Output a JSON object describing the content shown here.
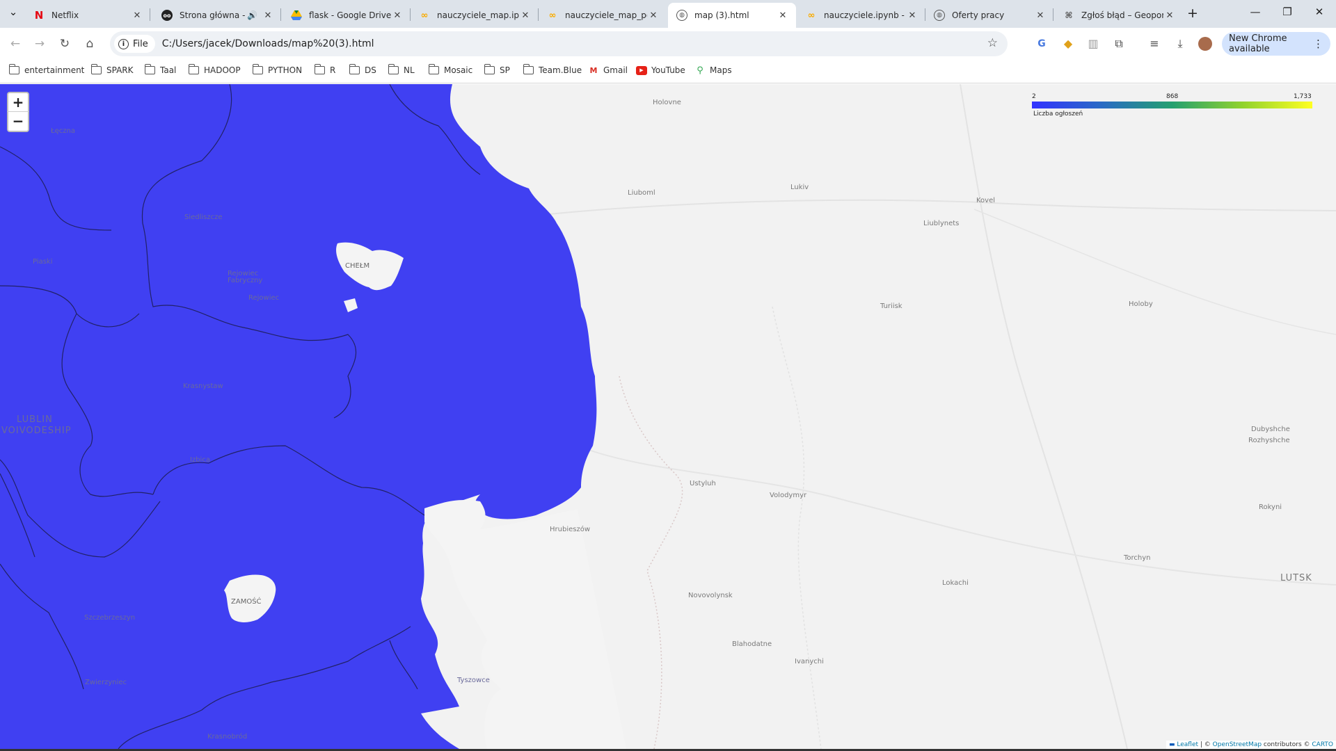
{
  "tabs": [
    {
      "title": "Netflix",
      "icon": "netflix-icon",
      "active": false
    },
    {
      "title": "Strona główna - P",
      "icon": "site-icon",
      "active": false
    },
    {
      "title": "flask - Google Drive",
      "icon": "google-drive-icon",
      "active": false
    },
    {
      "title": "nauczyciele_map.ipyn",
      "icon": "colab-icon",
      "active": false
    },
    {
      "title": "nauczyciele_map_pos",
      "icon": "colab-icon",
      "active": false
    },
    {
      "title": "map (3).html",
      "icon": "globe-icon",
      "active": true
    },
    {
      "title": "nauczyciele.ipynb - C",
      "icon": "colab-icon",
      "active": false
    },
    {
      "title": "Oferty pracy",
      "icon": "globe-icon",
      "active": false
    },
    {
      "title": "Zgłoś błąd – Geopor",
      "icon": "geoportal-icon",
      "active": false
    }
  ],
  "toolbar": {
    "chip_label": "File",
    "url": "C:/Users/jacek/Downloads/map%20(3).html",
    "update_label": "New Chrome available"
  },
  "bookmarks": [
    {
      "label": "entertainment",
      "icon": "folder-icon"
    },
    {
      "label": "SPARK",
      "icon": "folder-icon"
    },
    {
      "label": "Taal",
      "icon": "folder-icon"
    },
    {
      "label": "HADOOP",
      "icon": "folder-icon"
    },
    {
      "label": "PYTHON",
      "icon": "folder-icon"
    },
    {
      "label": "R",
      "icon": "folder-icon"
    },
    {
      "label": "DS",
      "icon": "folder-icon"
    },
    {
      "label": "NL",
      "icon": "folder-icon"
    },
    {
      "label": "Mosaic",
      "icon": "folder-icon"
    },
    {
      "label": "SP",
      "icon": "folder-icon"
    },
    {
      "label": "Team.Blue",
      "icon": "folder-icon"
    },
    {
      "label": "Gmail",
      "icon": "gmail-icon"
    },
    {
      "label": "YouTube",
      "icon": "youtube-icon"
    },
    {
      "label": "Maps",
      "icon": "maps-icon"
    }
  ],
  "map": {
    "zoom_in": "+",
    "zoom_out": "−",
    "legend": {
      "min": "2",
      "mid": "868",
      "max": "1,733",
      "caption": "Liczba ogłoszeń",
      "colors": [
        "#3333ff",
        "#2a6bc4",
        "#25a070",
        "#90d22e",
        "#ffff22"
      ]
    },
    "fill_color": "#4040f2",
    "places": {
      "holovne": "Holovne",
      "lukiv": "Lukiv",
      "liuboml": "Liuboml",
      "kovel": "Kovel",
      "liublynets": "Liublynets",
      "turiisk": "Turiisk",
      "holoby": "Holoby",
      "dubyshche": "Dubyshche",
      "rozhyshche": "Rozhyshche",
      "ustyluh": "Ustyluh",
      "volodymyr": "Volodymyr",
      "rokyni": "Rokyni",
      "hrubieszow": "Hrubieszów",
      "torchyn": "Torchyn",
      "lokachi": "Lokachi",
      "lutsk": "LUTSK",
      "novovolynsk": "Novovolynsk",
      "blahodatne": "Blahodatne",
      "ivanychi": "Ivanychi",
      "leczna": "Łęczna",
      "siedliszcze": "Siedliszcze",
      "chelm": "CHEŁM",
      "piaski": "Piaski",
      "rejowiec_fabryczny": "Rejowiec Fabryczny",
      "rejowiec": "Rejowiec",
      "krasnystaw": "Krasnystaw",
      "lublin_voivodeship_1": "LUBLIN",
      "lublin_voivodeship_2": "VOIVODESHIP",
      "izbica": "Izbica",
      "zamosc": "ZAMOŚĆ",
      "szczebrzeszyn": "Szczebrzeszyn",
      "zwierzyniec": "Zwierzyniec",
      "tyszowce": "Tyszowce",
      "krasnobrod": "Krasnobród"
    },
    "attribution": {
      "leaflet": "Leaflet",
      "sep": " | © ",
      "osm": "OpenStreetMap",
      "contrib": " contributors © ",
      "carto": "CARTO"
    }
  }
}
